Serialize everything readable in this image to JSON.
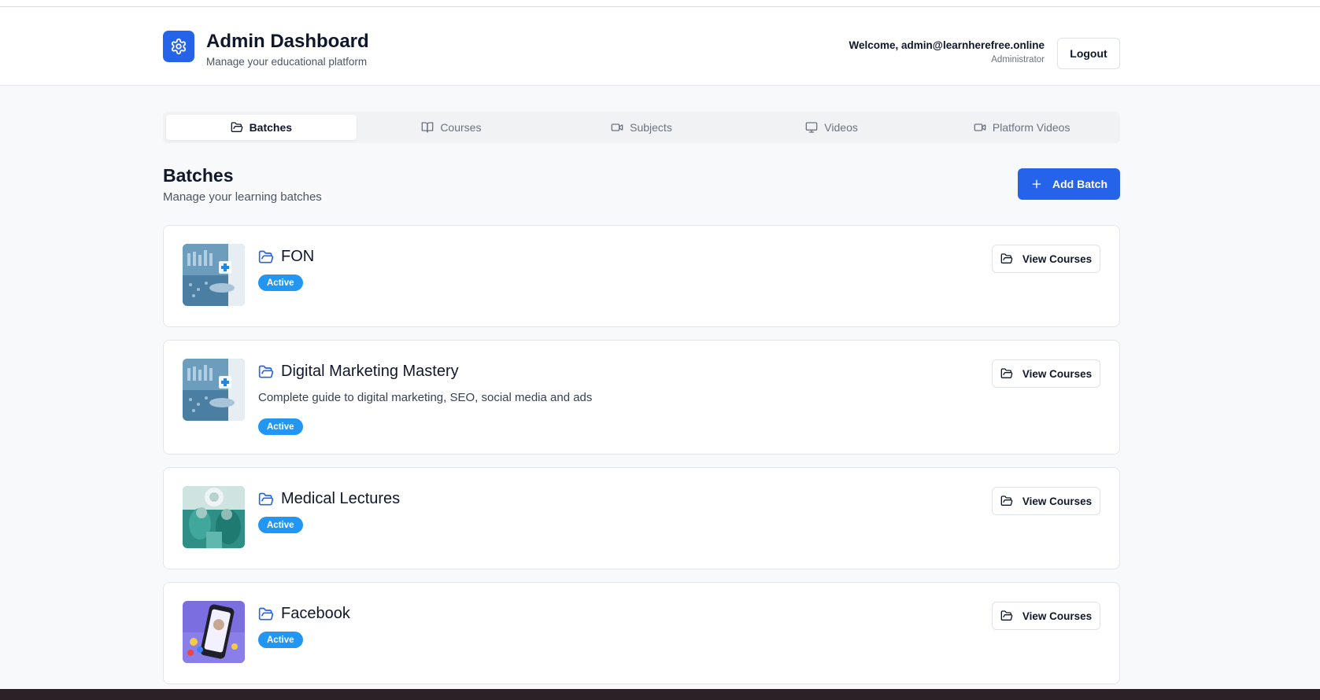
{
  "header": {
    "title": "Admin Dashboard",
    "subtitle": "Manage your educational platform",
    "welcome": "Welcome, admin@learnherefree.online",
    "role": "Administrator",
    "logout_label": "Logout",
    "brand_color": "#2563eb"
  },
  "tabs": [
    {
      "label": "Batches",
      "icon": "folder-open-icon",
      "active": true
    },
    {
      "label": "Courses",
      "icon": "book-open-icon",
      "active": false
    },
    {
      "label": "Subjects",
      "icon": "video-camera-icon",
      "active": false
    },
    {
      "label": "Videos",
      "icon": "monitor-icon",
      "active": false
    },
    {
      "label": "Platform Videos",
      "icon": "video-camera-icon",
      "active": false
    }
  ],
  "section": {
    "title": "Batches",
    "subtitle": "Manage your learning batches",
    "add_label": "Add Batch"
  },
  "batches": [
    {
      "title": "FON",
      "description": "",
      "status": "Active",
      "action": "View Courses",
      "thumbnail": "medical-hand-image"
    },
    {
      "title": "Digital Marketing Mastery",
      "description": "Complete guide to digital marketing, SEO, social media and ads",
      "status": "Active",
      "action": "View Courses",
      "thumbnail": "medical-hand-image"
    },
    {
      "title": "Medical Lectures",
      "description": "",
      "status": "Active",
      "action": "View Courses",
      "thumbnail": "surgery-image"
    },
    {
      "title": "Facebook",
      "description": "",
      "status": "Active",
      "action": "View Courses",
      "thumbnail": "phone-social-image"
    }
  ]
}
